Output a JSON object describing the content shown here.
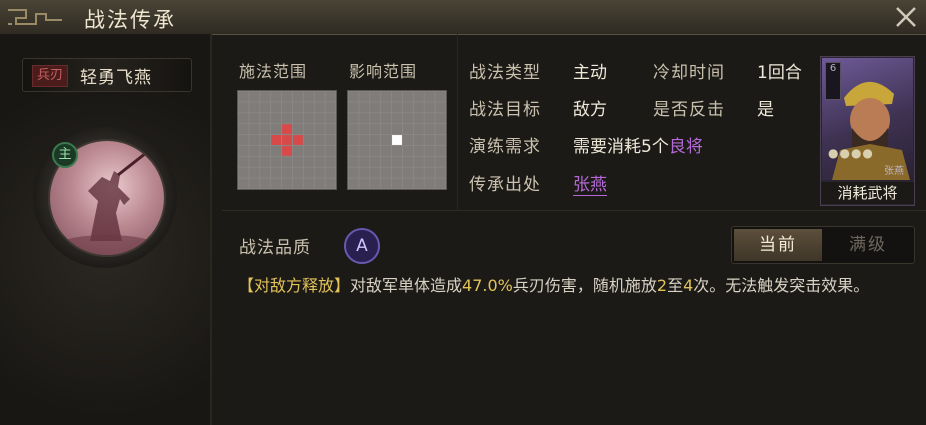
{
  "window": {
    "title": "战法传承"
  },
  "skill": {
    "type_badge": "兵刃",
    "name": "轻勇飞燕",
    "main_badge": "主"
  },
  "ranges": {
    "cast_label": "施法范围",
    "effect_label": "影响范围"
  },
  "attributes": {
    "type_label": "战法类型",
    "type_value": "主动",
    "cooldown_label": "冷却时间",
    "cooldown_value": "1回合",
    "target_label": "战法目标",
    "target_value": "敌方",
    "counter_label": "是否反击",
    "counter_value": "是",
    "train_label": "演练需求",
    "train_prefix": "需要消耗",
    "train_count": "5个",
    "train_item": "良将",
    "source_label": "传承出处",
    "source_value": "张燕"
  },
  "card": {
    "label": "消耗武将",
    "cost": "6",
    "name": "张燕",
    "stars": "●●●●"
  },
  "quality": {
    "label": "战法品质",
    "grade": "A"
  },
  "toggle": {
    "current": "当前",
    "max": "满级"
  },
  "description": {
    "condition": "【对敌方释放】",
    "part1": "对敌军单体造成",
    "rate": "47.0%",
    "part2": "兵刃伤害，随机施放",
    "min": "2",
    "part3": "至",
    "max": "4",
    "part4": "次。无法触发突击效果。"
  },
  "colors": {
    "accent_gold": "#e2c35a",
    "accent_purple": "#b46ad6",
    "cast_cell": "#d84a4a",
    "effect_cell": "#ffffff"
  }
}
